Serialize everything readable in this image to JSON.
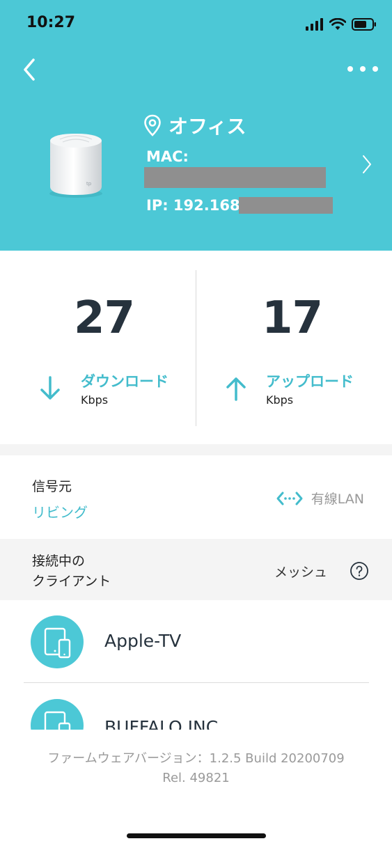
{
  "status_bar": {
    "time": "10:27"
  },
  "header": {
    "location_name": "オフィス",
    "mac_label": "MAC:",
    "ip_label": "IP: 192.168.1"
  },
  "speeds": {
    "download": {
      "value": "27",
      "label": "ダウンロード",
      "unit": "Kbps"
    },
    "upload": {
      "value": "17",
      "label": "アップロード",
      "unit": "Kbps"
    }
  },
  "signal_source": {
    "title": "信号元",
    "value": "リビング",
    "connection": "有線LAN"
  },
  "clients": {
    "title": "接続中の\nクライアント",
    "type": "メッシュ",
    "items": [
      {
        "name": "Apple-TV"
      },
      {
        "name": "BUFFALO INC"
      }
    ]
  },
  "firmware": {
    "line1": "ファームウェアバージョン：1.2.5 Build 20200709",
    "line2": "Rel. 49821"
  },
  "colors": {
    "accent": "#4cc8d6",
    "accent_text": "#43bccc"
  }
}
